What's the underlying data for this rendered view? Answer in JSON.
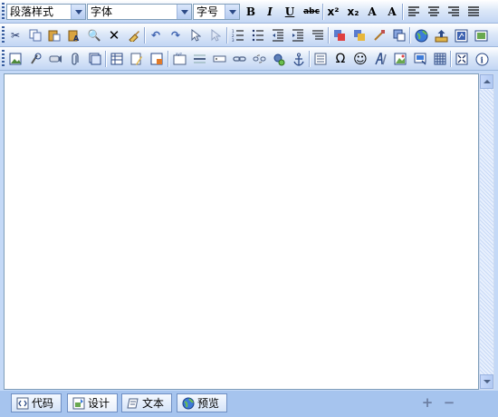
{
  "toolbar1": {
    "paragraph_style": "段落样式",
    "font": "字体",
    "font_size": "字号",
    "buttons": {
      "bold": "B",
      "italic": "I",
      "underline": "U",
      "strike": "abc",
      "superscript": "x²",
      "subscript": "x₂",
      "font_grow": "A",
      "font_shrink": "A"
    }
  },
  "toolbar2": {
    "icons": [
      "cut-icon",
      "copy-icon",
      "paste-icon",
      "paste-text-icon",
      "find-icon",
      "delete-icon",
      "clear-format-icon",
      "undo-icon",
      "redo-icon",
      "select-icon",
      "cursor-icon",
      "ordered-list-icon",
      "unordered-list-icon",
      "outdent-icon",
      "indent-icon",
      "paragraph-icon",
      "forecolor-icon",
      "backcolor-icon",
      "abs-position-icon",
      "z-order-icon",
      "globe-link-icon",
      "upload-icon",
      "insert-flash-icon",
      "insert-media-icon"
    ]
  },
  "toolbar3": {
    "icons": [
      "insert-image-icon",
      "attach-image-icon",
      "insert-sound-icon",
      "attachment-icon",
      "insert-frame-icon",
      "insert-table-icon",
      "insert-template-icon",
      "insert-form-icon",
      "insert-textarea-icon",
      "insert-hr-icon",
      "insert-input-icon",
      "insert-link-icon",
      "unlink-icon",
      "insert-bookmark-icon",
      "insert-anchor-icon",
      "page-break-icon",
      "special-char-icon",
      "emoticon-icon",
      "art-text-icon",
      "insert-image-2-icon",
      "insert-layer-icon",
      "grid-icon",
      "fullscreen-icon",
      "about-icon"
    ]
  },
  "footer": {
    "tabs": [
      {
        "id": "code",
        "label": "代码"
      },
      {
        "id": "design",
        "label": "设计"
      },
      {
        "id": "text",
        "label": "文本"
      },
      {
        "id": "preview",
        "label": "预览"
      }
    ],
    "zoom_in": "+",
    "zoom_out": "−"
  },
  "colors": {
    "toolbar": "#c2d6f4",
    "frame": "#a6c4ee",
    "accent": "#2c4a86"
  }
}
